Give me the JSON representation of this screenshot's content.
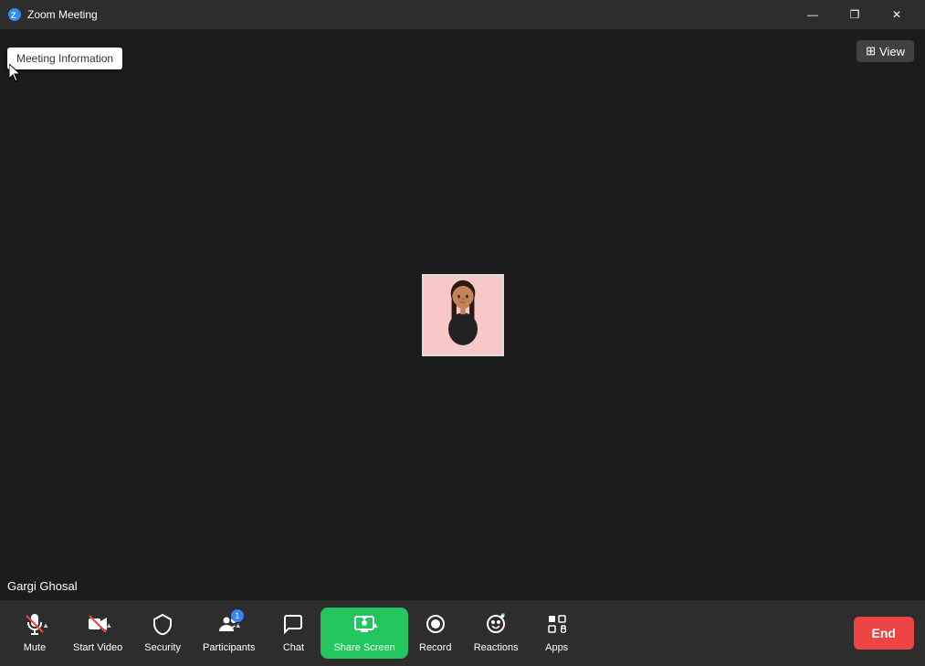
{
  "window": {
    "title": "Zoom Meeting",
    "icon": "zoom-icon"
  },
  "titlebar": {
    "minimize_label": "—",
    "restore_label": "❐",
    "close_label": "✕"
  },
  "header": {
    "view_label": "View",
    "view_icon": "view-icon"
  },
  "meeting_info_tooltip": {
    "label": "Meeting Information"
  },
  "participant": {
    "name": "Gargi Ghosal"
  },
  "toolbar": {
    "mute_label": "Mute",
    "start_video_label": "Start Video",
    "security_label": "Security",
    "participants_label": "Participants",
    "participants_count": "1",
    "chat_label": "Chat",
    "share_screen_label": "Share Screen",
    "record_label": "Record",
    "reactions_label": "Reactions",
    "apps_label": "Apps",
    "end_label": "End"
  }
}
